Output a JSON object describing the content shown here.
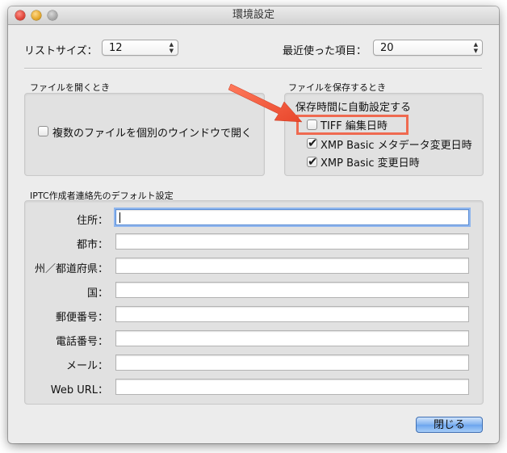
{
  "window": {
    "title": "環境設定"
  },
  "top": {
    "list_size_label": "リストサイズ：",
    "list_size_value": "12",
    "recent_items_label": "最近使った項目：",
    "recent_items_value": "20"
  },
  "open_section": {
    "title": "ファイルを開くとき",
    "checkbox_label": "複数のファイルを個別のウインドウで開く",
    "checkbox_checked": false
  },
  "save_section": {
    "title": "ファイルを保存するとき",
    "subtitle": "保存時間に自動設定する",
    "options": [
      {
        "label": "TIFF 編集日時",
        "checked": false
      },
      {
        "label": "XMP Basic メタデータ変更日時",
        "checked": true
      },
      {
        "label": "XMP Basic 変更日時",
        "checked": true
      }
    ]
  },
  "iptc_section": {
    "title": "IPTC作成者連絡先のデフォルト設定",
    "fields": [
      {
        "label": "住所：",
        "value": ""
      },
      {
        "label": "都市：",
        "value": ""
      },
      {
        "label": "州／都道府県：",
        "value": ""
      },
      {
        "label": "国：",
        "value": ""
      },
      {
        "label": "郵便番号：",
        "value": ""
      },
      {
        "label": "電話番号：",
        "value": ""
      },
      {
        "label": "メール：",
        "value": ""
      },
      {
        "label": "Web URL：",
        "value": ""
      }
    ]
  },
  "footer": {
    "close_label": "閉じる"
  },
  "colors": {
    "annotation": "#ef6a50",
    "accent": "#6ba4ee"
  }
}
